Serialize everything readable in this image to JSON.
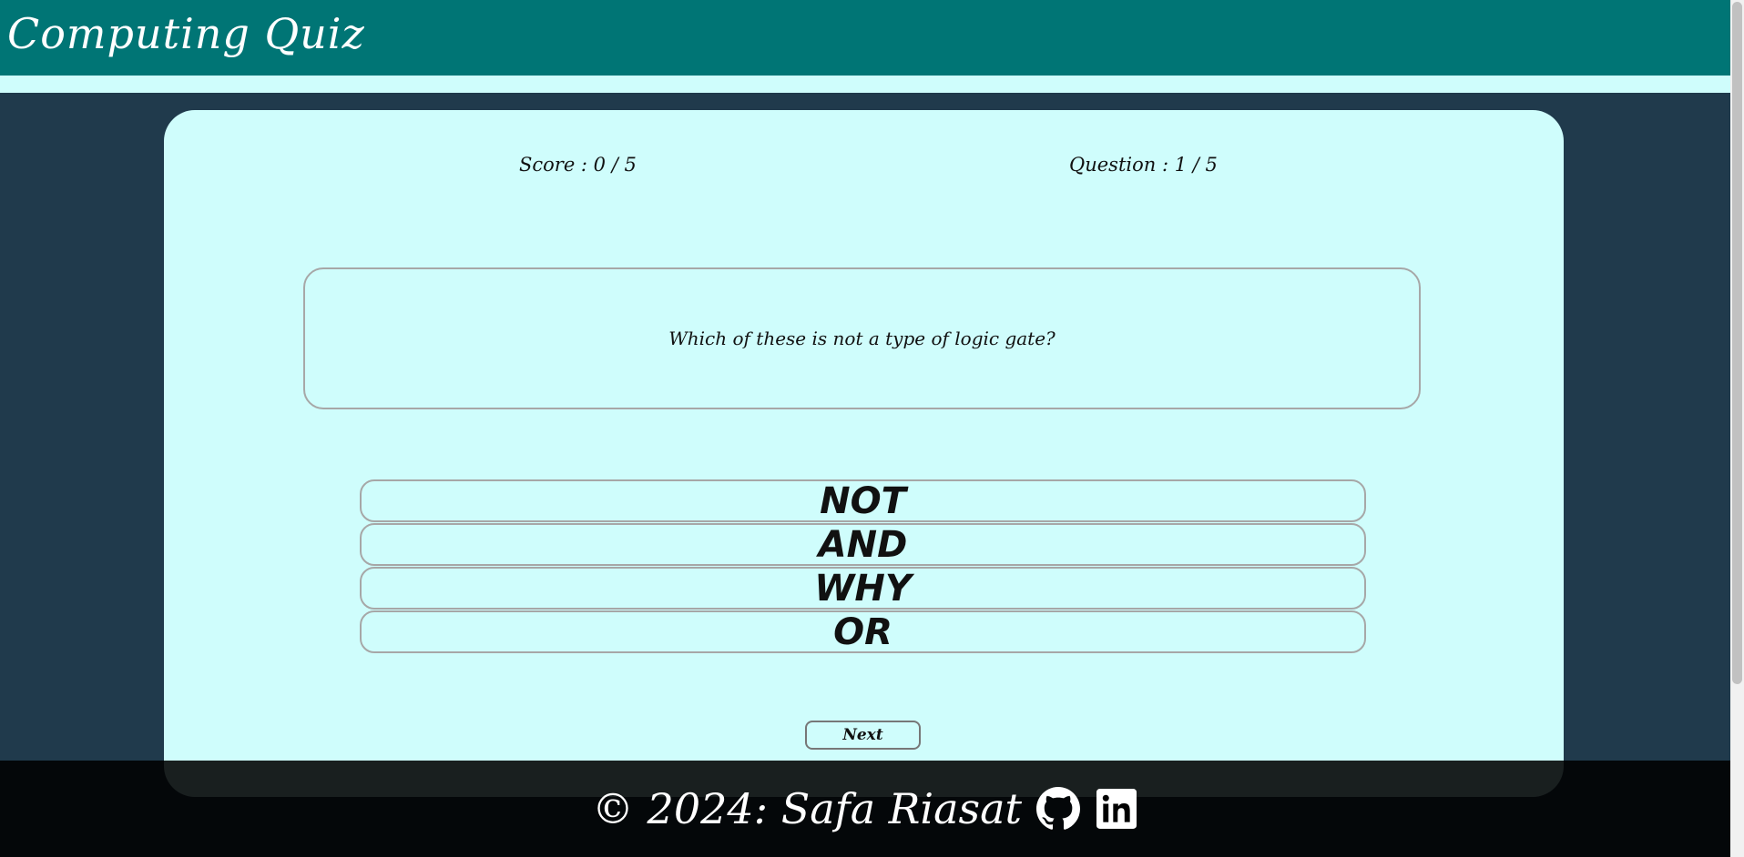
{
  "header": {
    "title": "Computing Quiz"
  },
  "quiz": {
    "score_text": "Score : 0 / 5",
    "question_counter_text": "Question : 1 / 5",
    "question_text": "Which of these is not a type of logic gate?",
    "answers": [
      "NOT",
      "AND",
      "WHY",
      "OR"
    ],
    "next_label": "Next"
  },
  "footer": {
    "copyright_text": "© 2024: Safa Riasat",
    "icons": [
      "github-icon",
      "linkedin-icon"
    ]
  },
  "colors": {
    "header": "#007575",
    "page_background": "#203a4c",
    "card_background": "#cffdfc",
    "border": "#a7a7a7",
    "footer": "#000000"
  }
}
